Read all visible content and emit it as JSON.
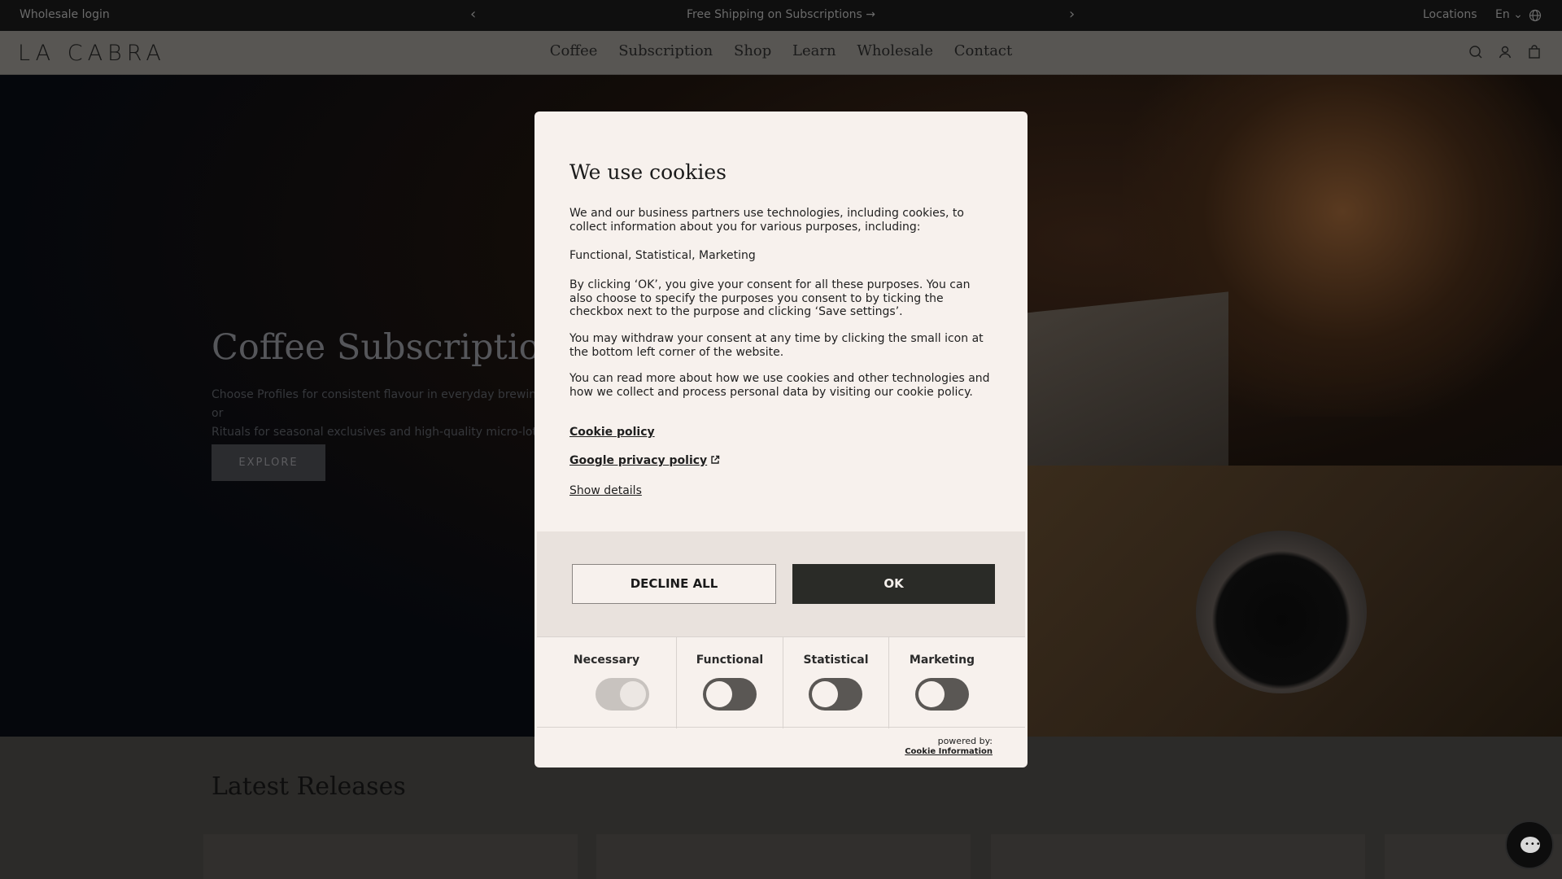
{
  "announcement": {
    "wholesale_login": "Wholesale login",
    "message": "Free Shipping on Subscriptions",
    "locations": "Locations",
    "language": "En"
  },
  "header": {
    "logo": "LA CABRA",
    "nav": [
      "Coffee",
      "Subscription",
      "Shop",
      "Learn",
      "Wholesale",
      "Contact"
    ],
    "icons": [
      "search-icon",
      "account-icon",
      "cart-icon"
    ]
  },
  "hero": {
    "title": "Coffee Subscriptions",
    "description_line1": "Choose Profiles for consistent flavour in everyday brewing, or",
    "description_line2": "Rituals for seasonal exclusives and high-quality micro-lots.",
    "cta": "EXPLORE"
  },
  "releases": {
    "title": "Latest Releases"
  },
  "cookie_modal": {
    "title": "We use cookies",
    "p1": "We and our business partners use technologies, including cookies, to collect information about you for various purposes, including:",
    "p2": "Functional, Statistical, Marketing",
    "p3": "By clicking ‘OK’, you give your consent for all these purposes. You can also choose to specify the purposes you consent to by ticking the checkbox next to the purpose and clicking ‘Save settings’.",
    "p4": "You may withdraw your consent at any time by clicking the small icon at the bottom left corner of the website.",
    "p5": "You can read more about how we use cookies and other technologies and how we collect and process personal data by visiting our cookie policy.",
    "cookie_policy_link": "Cookie policy",
    "google_policy_link": "Google privacy policy",
    "show_details": "Show details",
    "decline_label": "DECLINE ALL",
    "ok_label": "OK",
    "categories": [
      {
        "label": "Necessary",
        "enabled": true,
        "locked": true
      },
      {
        "label": "Functional",
        "enabled": false,
        "locked": false
      },
      {
        "label": "Statistical",
        "enabled": false,
        "locked": false
      },
      {
        "label": "Marketing",
        "enabled": false,
        "locked": false
      }
    ],
    "powered_by": "powered by:",
    "powered_brand": "Cookie Information"
  }
}
